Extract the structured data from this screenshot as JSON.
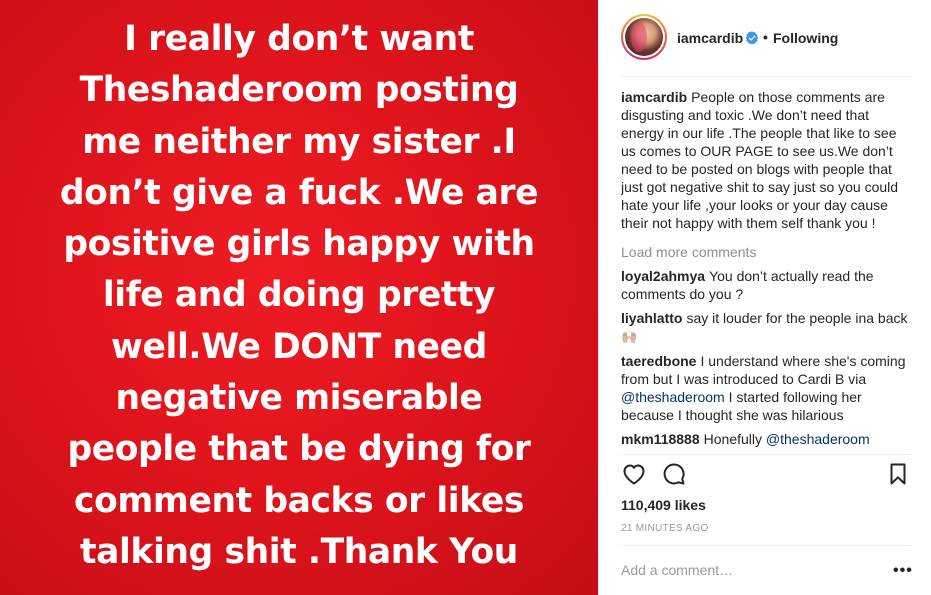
{
  "post": {
    "image_lines": [
      "I really don’t want",
      "Theshaderoom posting",
      "me neither my sister .I",
      "don’t give a fuck .We are",
      "positive girls happy with",
      "life and doing pretty",
      "well.We DONT need",
      "negative miserable",
      "people that be dying for",
      "comment backs or likes",
      "talking shit .Thank You"
    ],
    "background_color": "#e3151d"
  },
  "header": {
    "username": "iamcardib",
    "separator": "•",
    "follow_status": "Following"
  },
  "caption": {
    "user": "iamcardib",
    "text": "People on those comments are disgusting and toxic .We don’t need that energy in our life .The people that like to see us comes to OUR PAGE to see us.We don’t need to be posted on blogs with people that just got negative shit to say just so you could hate your life ,your looks or your day cause their not happy with them self thank you !"
  },
  "load_more_label": "Load more comments",
  "comments": [
    {
      "user": "loyal2ahmya",
      "text": "You don’t actually read the comments do you ?"
    },
    {
      "user": "liyahlatto",
      "text": "say it louder for the people ina back",
      "emoji": "🙌🏼"
    },
    {
      "user": "taeredbone",
      "text_before": "I understand where she's coming from but I was introduced to Cardi B via ",
      "mention": "@theshaderoom",
      "text_after": " I started following her because I thought she was hilarious"
    },
    {
      "user": "mkm118888",
      "text_before": "Honefully ",
      "mention": "@theshaderoom"
    }
  ],
  "likes": "110,409 likes",
  "timestamp": "21 MINUTES AGO",
  "add_comment_placeholder": "Add a comment…",
  "more_label": "•••",
  "icons": {
    "like": "heart-icon",
    "comment": "comment-bubble-icon",
    "save": "bookmark-icon",
    "verified": "verified-badge-icon"
  },
  "colors": {
    "verified_blue": "#3897f0",
    "mention": "#003569",
    "muted": "#8e8e8e"
  }
}
